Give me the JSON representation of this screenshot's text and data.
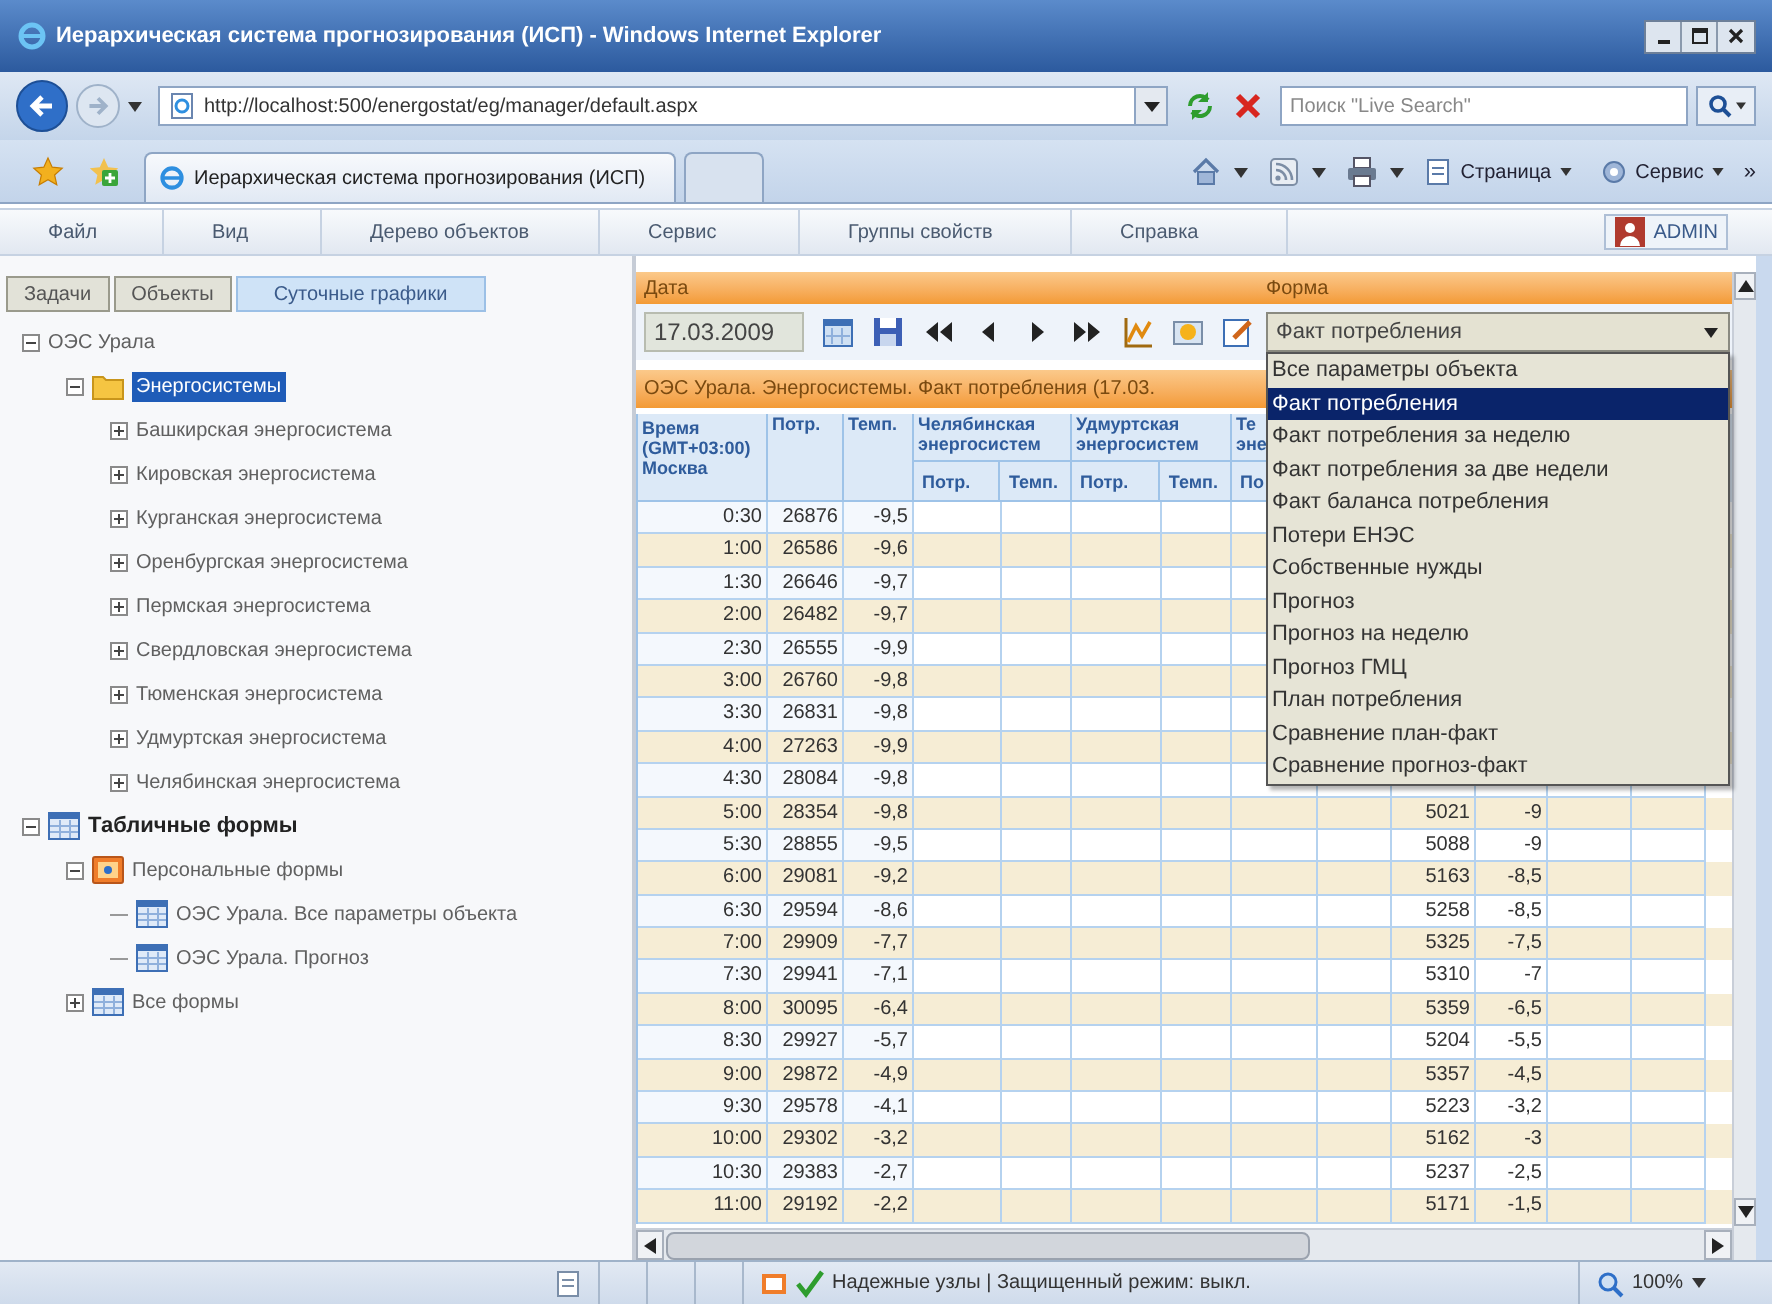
{
  "window": {
    "title": "Иерархическая система прогнозирования (ИСП) - Windows Internet Explorer"
  },
  "address_bar": {
    "url": "http://localhost:500/energostat/eg/manager/default.aspx"
  },
  "search": {
    "placeholder": "Поиск \"Live Search\""
  },
  "browser_tab": {
    "title": "Иерархическая система прогнозирования (ИСП)"
  },
  "command_bar": {
    "items": [
      "Страница",
      "Сервис"
    ],
    "overflow": "»"
  },
  "menu": {
    "items": [
      "Файл",
      "Вид",
      "Дерево объектов",
      "Сервис",
      "Группы свойств",
      "Справка"
    ],
    "user": "ADMIN"
  },
  "left_tabs": [
    {
      "label": "Задачи",
      "selected": false
    },
    {
      "label": "Объекты",
      "selected": false
    },
    {
      "label": "Суточные графики",
      "selected": true
    }
  ],
  "tree": [
    {
      "label": "ОЭС Урала",
      "kind": "plain",
      "expanded": true,
      "selected": false,
      "children": [
        {
          "label": "Энергосистемы",
          "kind": "folder",
          "expanded": true,
          "selected": true,
          "children": [
            {
              "label": "Башкирская энергосистема",
              "kind": "plain",
              "expanded": false,
              "selected": false
            },
            {
              "label": "Кировская энергосистема",
              "kind": "plain",
              "expanded": false,
              "selected": false
            },
            {
              "label": "Курганская энергосистема",
              "kind": "plain",
              "expanded": false,
              "selected": false
            },
            {
              "label": "Оренбургская энергосистема",
              "kind": "plain",
              "expanded": false,
              "selected": false
            },
            {
              "label": "Пермская энергосистема",
              "kind": "plain",
              "expanded": false,
              "selected": false
            },
            {
              "label": "Свердловская энергосистема",
              "kind": "plain",
              "expanded": false,
              "selected": false
            },
            {
              "label": "Тюменская энергосистема",
              "kind": "plain",
              "expanded": false,
              "selected": false
            },
            {
              "label": "Удмуртская энергосистема",
              "kind": "plain",
              "expanded": false,
              "selected": false
            },
            {
              "label": "Челябинская энергосистема",
              "kind": "plain",
              "expanded": false,
              "selected": false
            }
          ]
        }
      ]
    },
    {
      "label": "Табличные формы",
      "kind": "section",
      "expanded": true,
      "selected": false,
      "children": [
        {
          "label": "Персональные формы",
          "kind": "personal",
          "expanded": true,
          "selected": false,
          "children": [
            {
              "label": "ОЭС Урала. Все параметры объекта",
              "kind": "form",
              "selected": false
            },
            {
              "label": "ОЭС Урала. Прогноз",
              "kind": "form",
              "selected": false
            }
          ]
        },
        {
          "label": "Все формы",
          "kind": "table",
          "expanded": false,
          "selected": false
        }
      ]
    }
  ],
  "form_panel": {
    "date_label": "Дата",
    "form_label": "Форма",
    "date": "17.03.2009",
    "form": "Факт потребления",
    "options": [
      {
        "label": "Все параметры объекта",
        "selected": false
      },
      {
        "label": "Факт потребления",
        "selected": true
      },
      {
        "label": "Факт потребления за неделю",
        "selected": false
      },
      {
        "label": "Факт потребления за две недели",
        "selected": false
      },
      {
        "label": "Факт баланса потребления",
        "selected": false
      },
      {
        "label": "Потери ЕНЭС",
        "selected": false
      },
      {
        "label": "Собственные нужды",
        "selected": false
      },
      {
        "label": "Прогноз",
        "selected": false
      },
      {
        "label": "Прогноз на неделю",
        "selected": false
      },
      {
        "label": "Прогноз ГМЦ",
        "selected": false
      },
      {
        "label": "План потребления",
        "selected": false
      },
      {
        "label": "Сравнение план-факт",
        "selected": false
      },
      {
        "label": "Сравнение прогноз-факт",
        "selected": false
      }
    ]
  },
  "table": {
    "caption": "ОЭС Урала. Энергосистемы. Факт потребления (17.03.",
    "columns": [
      "Время (GMT+03:00) Москва",
      "Потр.",
      "Темп."
    ],
    "column_groups": [
      {
        "title": "Челябинская энергосистем",
        "subcolumns": [
          "Потр.",
          "Темп."
        ]
      },
      {
        "title": "Удмуртская энергосистем",
        "subcolumns": [
          "Потр.",
          "Темп."
        ]
      },
      {
        "title": "Те эне",
        "subcolumns": [
          "По"
        ]
      }
    ],
    "rows": [
      {
        "time": "0:30",
        "load": "26876",
        "temp": "-9,5"
      },
      {
        "time": "1:00",
        "load": "26586",
        "temp": "-9,6"
      },
      {
        "time": "1:30",
        "load": "26646",
        "temp": "-9,7"
      },
      {
        "time": "2:00",
        "load": "26482",
        "temp": "-9,7"
      },
      {
        "time": "2:30",
        "load": "26555",
        "temp": "-9,9"
      },
      {
        "time": "3:00",
        "load": "26760",
        "temp": "-9,8"
      },
      {
        "time": "3:30",
        "load": "26831",
        "temp": "-9,8"
      },
      {
        "time": "4:00",
        "load": "27263",
        "temp": "-9,9"
      },
      {
        "time": "4:30",
        "load": "28084",
        "temp": "-9,8"
      },
      {
        "time": "5:00",
        "load": "28354",
        "temp": "-9,8",
        "group_4_load": "5021",
        "group_4_temp": "-9"
      },
      {
        "time": "5:30",
        "load": "28855",
        "temp": "-9,5",
        "group_4_load": "5088",
        "group_4_temp": "-9"
      },
      {
        "time": "6:00",
        "load": "29081",
        "temp": "-9,2",
        "group_4_load": "5163",
        "group_4_temp": "-8,5"
      },
      {
        "time": "6:30",
        "load": "29594",
        "temp": "-8,6",
        "group_4_load": "5258",
        "group_4_temp": "-8,5"
      },
      {
        "time": "7:00",
        "load": "29909",
        "temp": "-7,7",
        "group_4_load": "5325",
        "group_4_temp": "-7,5"
      },
      {
        "time": "7:30",
        "load": "29941",
        "temp": "-7,1",
        "group_4_load": "5310",
        "group_4_temp": "-7"
      },
      {
        "time": "8:00",
        "load": "30095",
        "temp": "-6,4",
        "group_4_load": "5359",
        "group_4_temp": "-6,5"
      },
      {
        "time": "8:30",
        "load": "29927",
        "temp": "-5,7",
        "group_4_load": "5204",
        "group_4_temp": "-5,5"
      },
      {
        "time": "9:00",
        "load": "29872",
        "temp": "-4,9",
        "group_4_load": "5357",
        "group_4_temp": "-4,5"
      },
      {
        "time": "9:30",
        "load": "29578",
        "temp": "-4,1",
        "group_4_load": "5223",
        "group_4_temp": "-3,2"
      },
      {
        "time": "10:00",
        "load": "29302",
        "temp": "-3,2",
        "group_4_load": "5162",
        "group_4_temp": "-3"
      },
      {
        "time": "10:30",
        "load": "29383",
        "temp": "-2,7",
        "group_4_load": "5237",
        "group_4_temp": "-2,5"
      },
      {
        "time": "11:00",
        "load": "29192",
        "temp": "-2,2",
        "group_4_load": "5171",
        "group_4_temp": "-1,5"
      }
    ]
  },
  "status_bar": {
    "security": "Надежные узлы | Защищенный режим: выкл.",
    "zoom": "100%"
  }
}
